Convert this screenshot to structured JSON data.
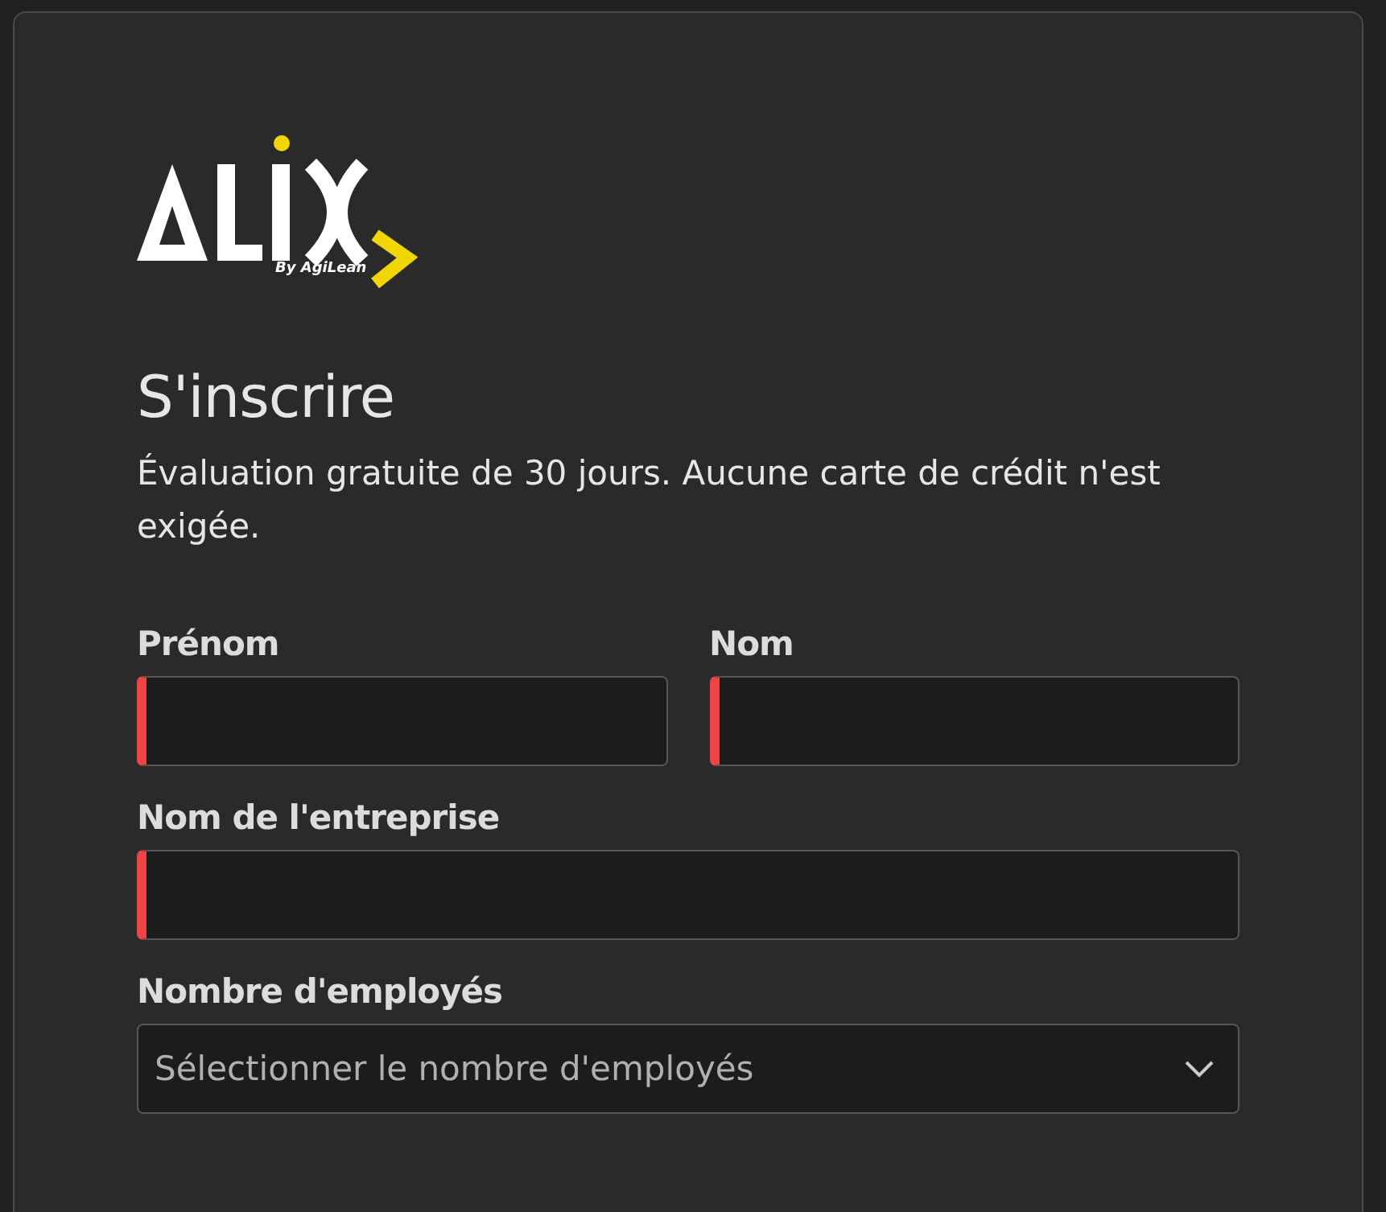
{
  "logo": {
    "byline": "By AgiLean"
  },
  "title": "S'inscrire",
  "subtitle": "Évaluation gratuite de 30 jours. Aucune carte de crédit n'est exigée.",
  "fields": [
    {
      "kind": "text",
      "label": "Prénom",
      "invalid": true
    },
    {
      "kind": "text",
      "label": "Nom",
      "invalid": true
    },
    {
      "kind": "text",
      "label": "Nom de l'entreprise",
      "invalid": true
    },
    {
      "kind": "select",
      "label": "Nombre d'employés",
      "placeholder": "Sélectionner le nombre d'employés",
      "invalid": false
    }
  ]
}
